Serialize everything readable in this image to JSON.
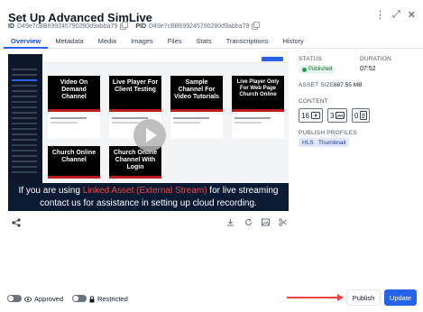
{
  "header": {
    "title": "Set Up Advanced SimLive",
    "id_label": "ID",
    "id_value": "D49e7cBB6992457902​80d9abba79",
    "pid_label": "PID",
    "pid_value": "D49e7cBB6992457902​80d9abba79",
    "actions": {
      "more": "⋮",
      "expand": "⤢",
      "close": "✕"
    }
  },
  "tabs": [
    {
      "label": "Overview",
      "active": true
    },
    {
      "label": "Metadata"
    },
    {
      "label": "Media"
    },
    {
      "label": "Images"
    },
    {
      "label": "Files"
    },
    {
      "label": "Stats"
    },
    {
      "label": "Transcriptions"
    },
    {
      "label": "History"
    }
  ],
  "preview": {
    "cards": [
      {
        "text": "Video On Demand Channel"
      },
      {
        "text": "Live Player For Client Testing"
      },
      {
        "text": "Sample Channel For Video Tutorials"
      },
      {
        "text": "Live Player Only For Web Page Church Online"
      },
      {
        "text": "Church Online Channel"
      },
      {
        "text": "Church Online Channel With Login"
      }
    ],
    "banner": {
      "line1_a": "If you are using ",
      "line1_highlight": "Linked Asset (External Stream)",
      "line1_b": " for live streaming",
      "line2": "contact us for assistance in setting up cloud recording."
    }
  },
  "meta": {
    "status_label": "STATUS",
    "status_value": "Published",
    "duration_label": "DURATION",
    "duration_value": "07:52",
    "asset_size_label": "ASSET SIZE",
    "asset_size_value": "887.55 MB",
    "content_label": "CONTENT",
    "content": [
      {
        "count": "16",
        "icon": "video-icon"
      },
      {
        "count": "3",
        "icon": "image-icon"
      },
      {
        "count": "0",
        "icon": "document-icon"
      }
    ],
    "profiles_label": "PUBLISH PROFILES",
    "profiles": [
      "HLS",
      "Thumbnail"
    ]
  },
  "footer": {
    "approved_label": "Approved",
    "restricted_label": "Restricted",
    "publish_label": "Publish",
    "update_label": "Update"
  },
  "colors": {
    "accent": "#2563eb",
    "published": "#16a34a",
    "arrow": "#ef4444"
  }
}
